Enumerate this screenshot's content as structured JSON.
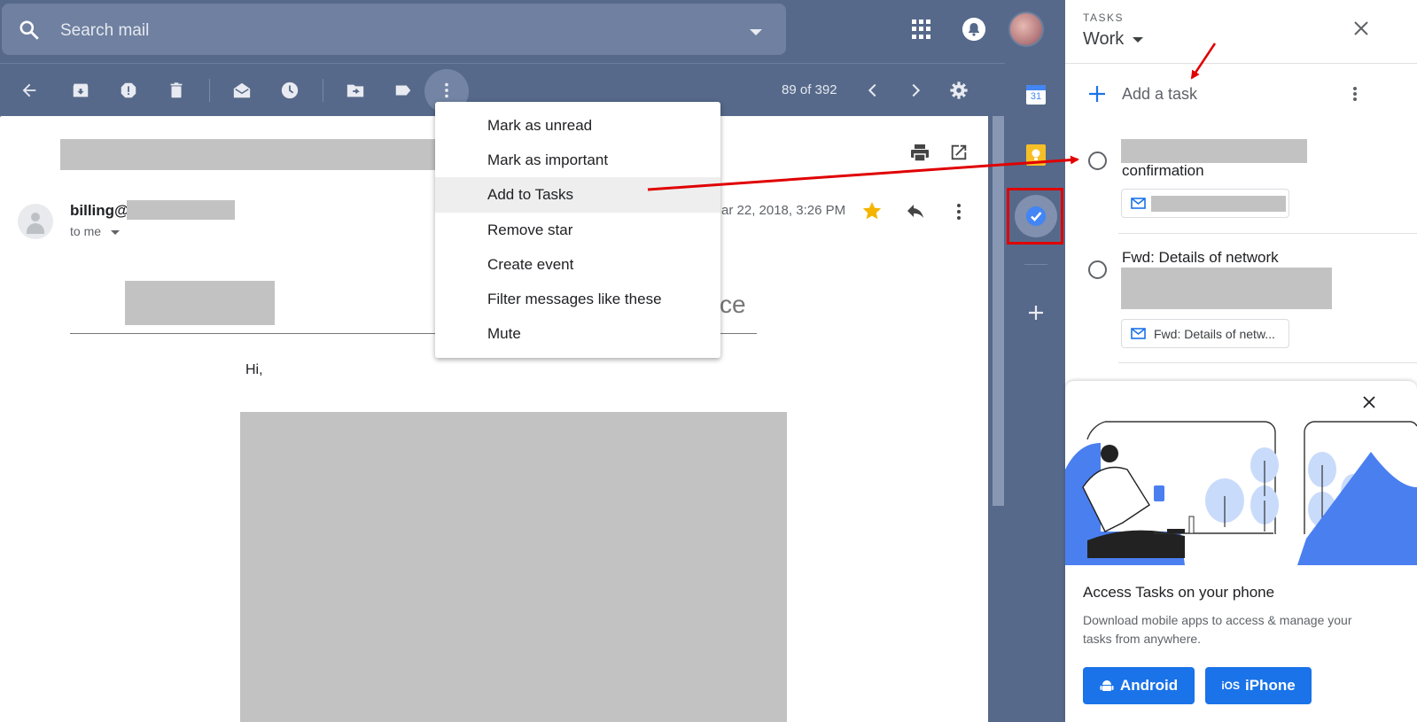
{
  "search": {
    "placeholder": "Search mail"
  },
  "toolbar": {
    "page_count": "89 of 392"
  },
  "mail": {
    "sender": "billing@",
    "recipient": "to me",
    "date": "ar 22, 2018, 3:26 PM",
    "headline_tail": "ce",
    "greeting": "Hi,"
  },
  "context_menu": {
    "items": [
      "Mark as unread",
      "Mark as important",
      "Add to Tasks",
      "Remove star",
      "Create event",
      "Filter messages like these",
      "Mute"
    ],
    "highlighted": "Add to Tasks"
  },
  "rail": {
    "calendar_day": "31"
  },
  "tasks": {
    "label": "TASKS",
    "list_name": "Work",
    "add_task": "Add a task",
    "items": [
      {
        "title_tail": "confirmation"
      },
      {
        "title": "Fwd: Details of network",
        "chip": "Fwd: Details of netw..."
      }
    ]
  },
  "promo": {
    "title": "Access Tasks on your phone",
    "description": "Download mobile apps to access & manage your tasks from anywhere.",
    "android_label": "Android",
    "ios_badge": "iOS",
    "iphone_label": "iPhone"
  },
  "colors": {
    "accent": "#1a73e8",
    "toolbar_bg": "#56698a",
    "annotation": "#e00000"
  },
  "icons": [
    "search-icon",
    "apps-icon",
    "bell-icon",
    "back-arrow-icon",
    "archive-icon",
    "spam-icon",
    "delete-icon",
    "mark-read-icon",
    "snooze-icon",
    "move-icon",
    "label-icon",
    "more-vert-icon",
    "chevron-left-icon",
    "chevron-right-icon",
    "gear-icon",
    "print-icon",
    "open-new-window-icon",
    "star-icon",
    "reply-icon",
    "calendar-icon",
    "keep-icon",
    "tasks-icon",
    "plus-icon",
    "close-icon",
    "mail-icon",
    "android-icon"
  ]
}
